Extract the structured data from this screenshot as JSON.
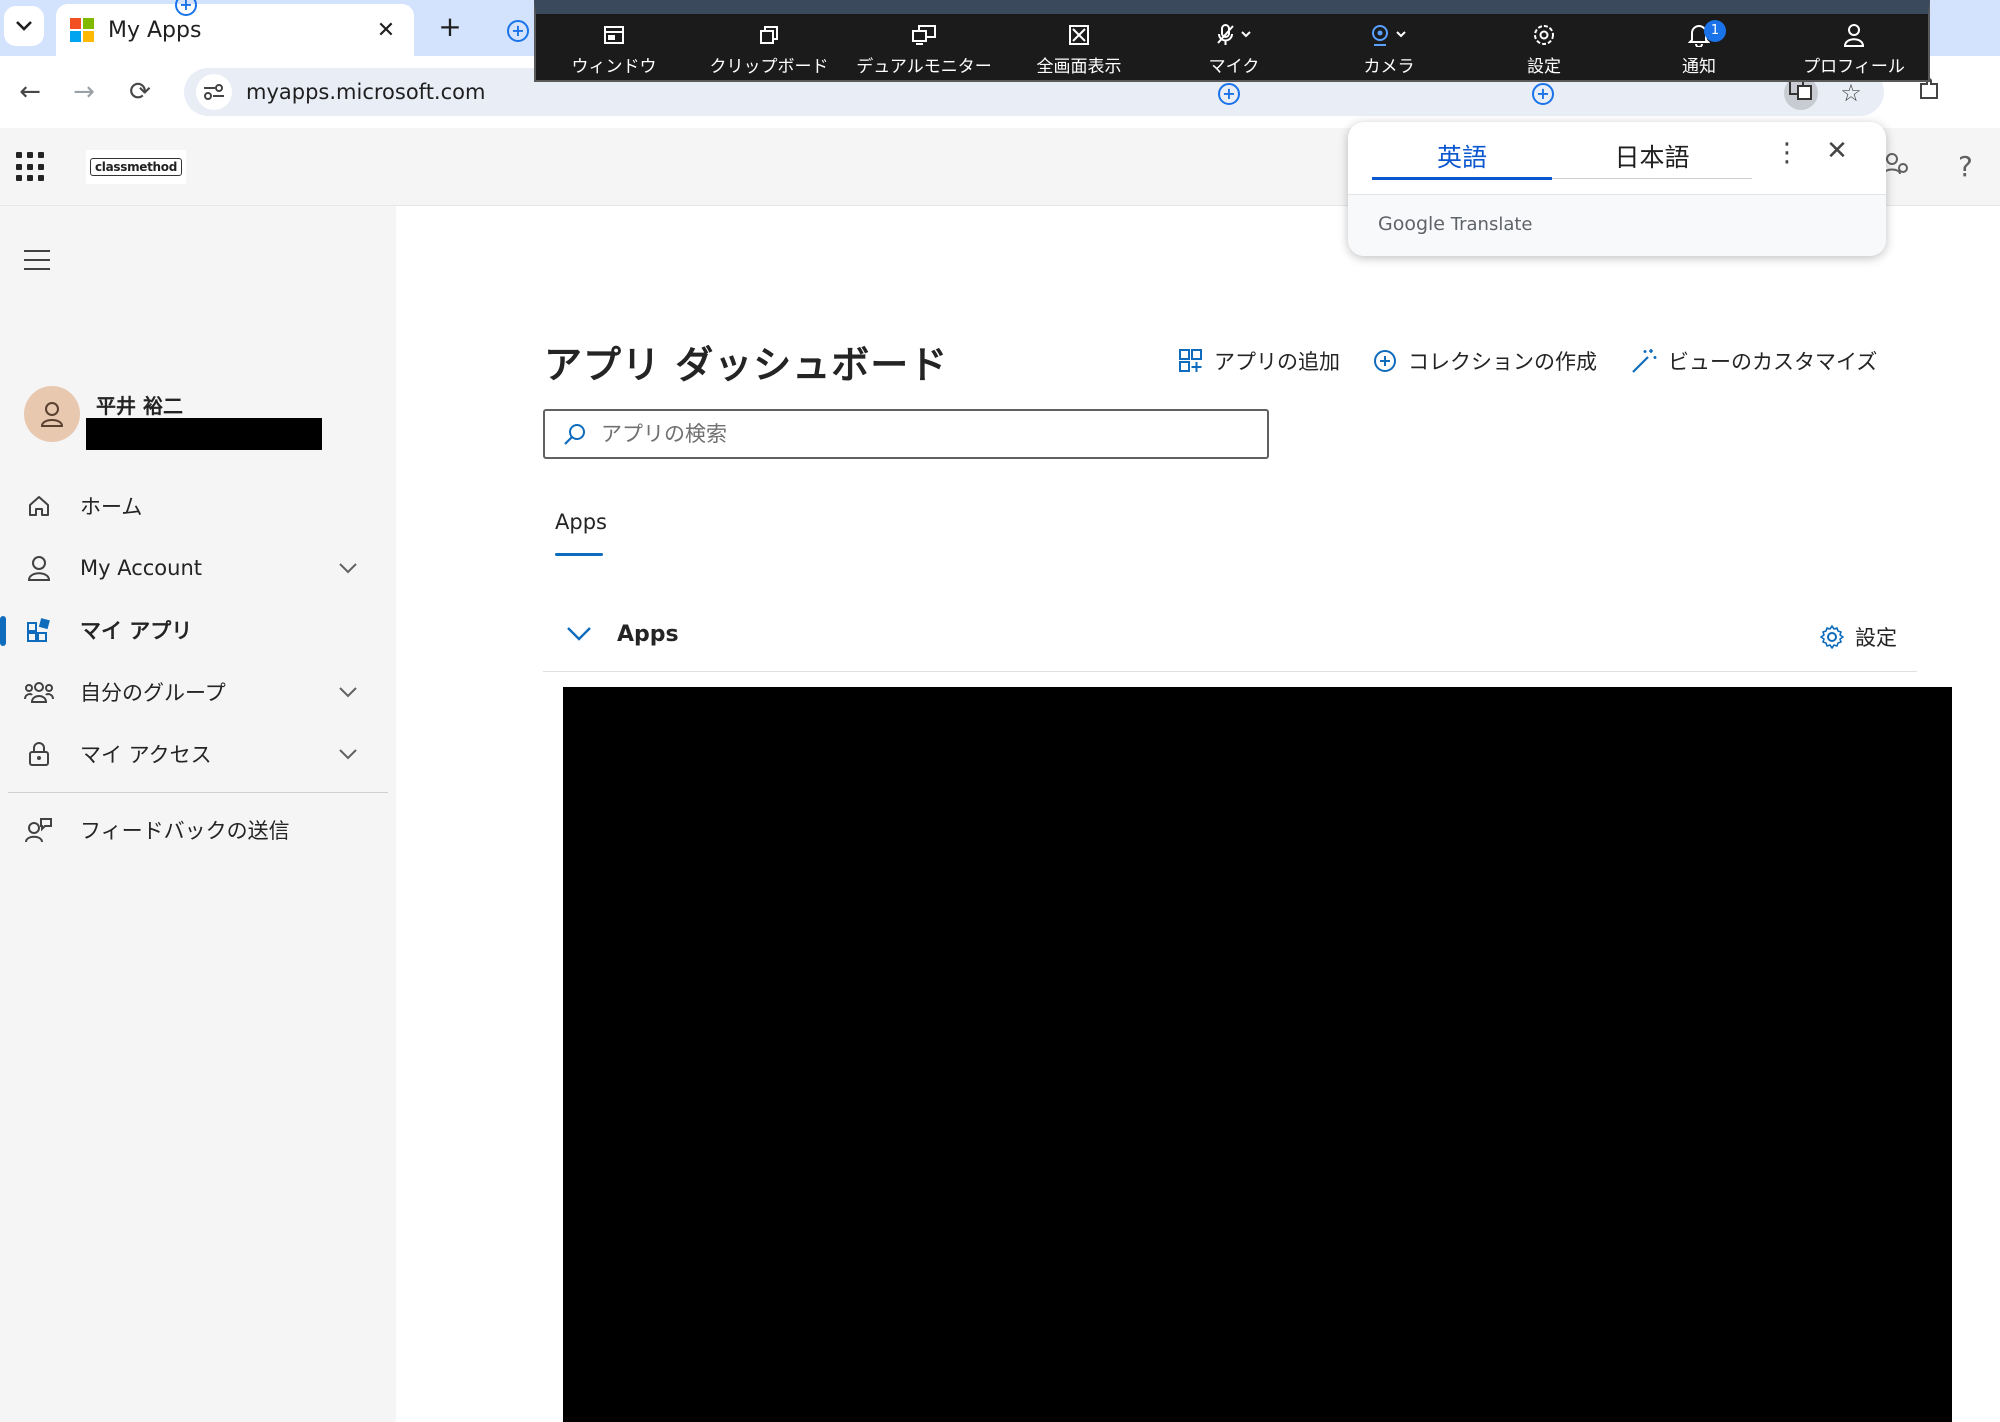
{
  "browser": {
    "tab_title": "My Apps",
    "url": "myapps.microsoft.com",
    "ms_logo_colors": [
      "#f25022",
      "#7fba00",
      "#00a4ef",
      "#ffb900"
    ]
  },
  "remote_toolbar": {
    "items": [
      {
        "icon": "window-icon",
        "label": "ウィンドウ"
      },
      {
        "icon": "clipboard-icon",
        "label": "クリップボード"
      },
      {
        "icon": "dual-monitor-icon",
        "label": "デュアルモニター"
      },
      {
        "icon": "fullscreen-icon",
        "label": "全画面表示"
      },
      {
        "icon": "microphone-muted-icon",
        "label": "マイク"
      },
      {
        "icon": "camera-icon",
        "label": "カメラ"
      },
      {
        "icon": "settings-gear-icon",
        "label": "設定"
      },
      {
        "icon": "notification-bell-icon",
        "label": "通知",
        "badge": "1"
      },
      {
        "icon": "profile-icon",
        "label": "プロフィール"
      }
    ]
  },
  "translate_popup": {
    "tab_source": "英語",
    "tab_target": "日本語",
    "brand_google": "Google",
    "brand_translate": "Translate"
  },
  "sidebar": {
    "user_name": "平井 裕二",
    "nav": [
      {
        "icon": "home-icon",
        "label": "ホーム"
      },
      {
        "icon": "person-icon",
        "label": "My Account"
      },
      {
        "icon": "my-apps-icon",
        "label": "マイ アプリ"
      },
      {
        "icon": "people-group-icon",
        "label": "自分のグループ"
      },
      {
        "icon": "lock-icon",
        "label": "マイ アクセス"
      },
      {
        "icon": "feedback-icon",
        "label": "フィードバックの送信"
      }
    ]
  },
  "main": {
    "title": "アプリ ダッシュボード",
    "actions": {
      "add_app": "アプリの追加",
      "create_collection": "コレクションの作成",
      "customize_view": "ビューのカスタマイズ"
    },
    "search_placeholder": "アプリの検索",
    "tab": "Apps",
    "section_title": "Apps",
    "section_settings": "設定"
  },
  "colors": {
    "accent": "#0f6cbd",
    "sidebar_bg": "#f5f5f5",
    "tabstrip_bg": "#d3e3fd"
  }
}
